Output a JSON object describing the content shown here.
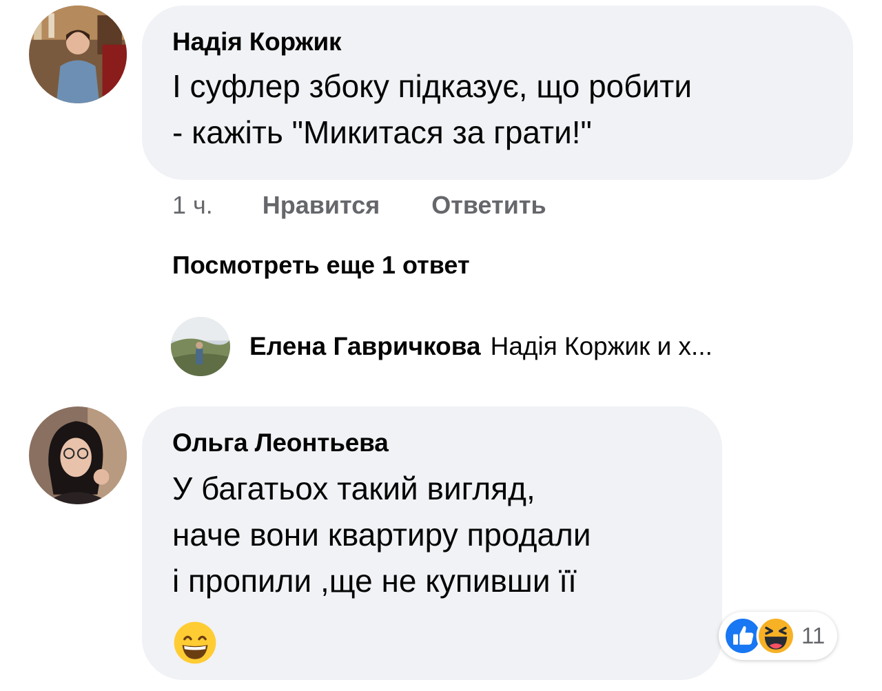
{
  "comments": [
    {
      "author": "Надія Коржик",
      "lines": [
        "І суфлер збоку підказує, що робити",
        "- кажіть \"Микитася за грати!\""
      ],
      "time": "1 ч.",
      "like_label": "Нравится",
      "reply_label": "Ответить",
      "avatar_icon": "profile-photo"
    },
    {
      "author": "Ольга Леонтьева",
      "lines": [
        "У багатьох такий вигляд,",
        "наче вони квартиру продали",
        "і пропили ,ще не купивши її"
      ],
      "emoji_icon": "grinning-smiling-eyes-emoji",
      "avatar_icon": "profile-photo",
      "reactions": {
        "icons": [
          "like-reaction-icon",
          "haha-reaction-icon"
        ],
        "count": "11",
        "like_color": "#1877f2",
        "haha_color": "#f7b125"
      }
    }
  ],
  "more_replies": "Посмотреть еще 1 ответ",
  "reply_preview": {
    "author": "Елена Гавричкова",
    "snippet": "Надія Коржик и х..."
  },
  "colors": {
    "bubble": "#f0f2f5",
    "secondary_text": "#65676b",
    "primary_text": "#050505"
  }
}
